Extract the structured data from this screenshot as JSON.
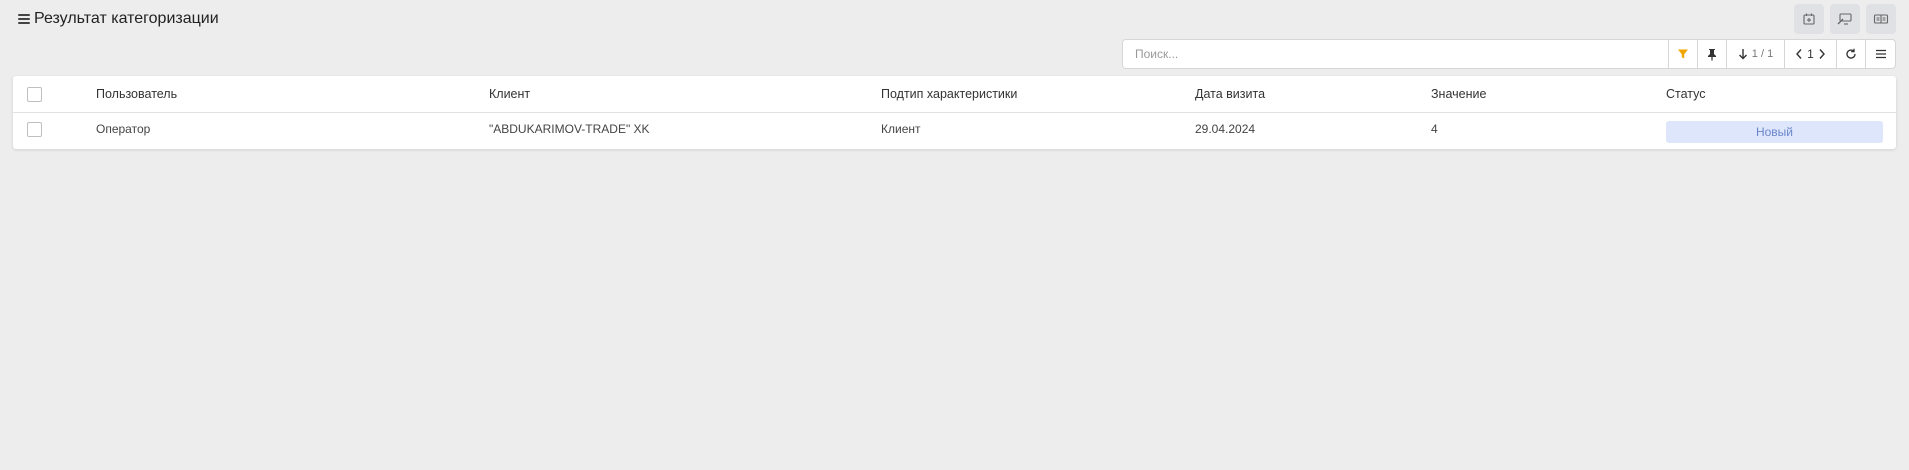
{
  "header": {
    "title": "Результат категоризации",
    "menu_icon": "hamburger-icon"
  },
  "top_actions": [
    {
      "icon": "calendar-add-icon"
    },
    {
      "icon": "monitor-edit-icon"
    },
    {
      "icon": "card-icon"
    }
  ],
  "toolbar": {
    "search_placeholder": "Поиск...",
    "filter_icon": "filter-icon",
    "filter_color": "#f0a500",
    "pin_icon": "pin-icon",
    "sort_icon": "arrow-down-icon",
    "sort_text": "1 / 1",
    "page_number": "1",
    "refresh_icon": "refresh-icon",
    "menu_icon": "menu-icon"
  },
  "table": {
    "columns": [
      "Пользователь",
      "Клиент",
      "Подтип характеристики",
      "Дата визита",
      "Значение",
      "Статус"
    ],
    "rows": [
      {
        "user": "Оператор",
        "client": "\"ABDUKARIMOV-TRADE\" XK",
        "subtype": "Клиент",
        "visit_date": "29.04.2024",
        "value": "4",
        "status": "Новый"
      }
    ]
  },
  "colors": {
    "status_bg": "#dde6fb",
    "status_text": "#6b86c9",
    "page_bg": "#ededed"
  }
}
